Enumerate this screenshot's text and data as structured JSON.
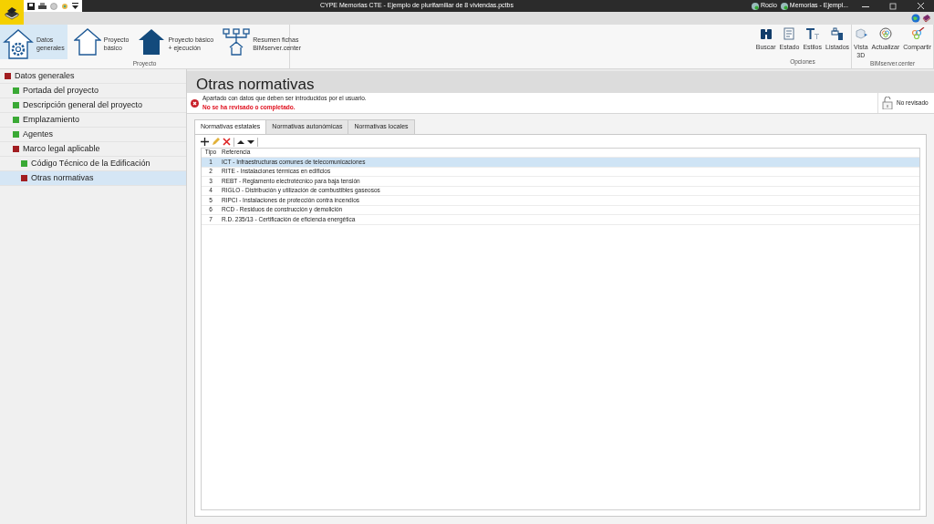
{
  "window": {
    "title": "CYPE Memorias CTE - Ejemplo de plurifamiliar de 8 viviendas.pctbs",
    "user": "Rocio",
    "document": "Memorias - Ejempl..."
  },
  "ribbon": {
    "groups": [
      {
        "label": "Proyecto",
        "buttons": [
          {
            "lines": [
              "Datos",
              "generales"
            ],
            "selected": true
          },
          {
            "lines": [
              "Proyecto",
              "básico"
            ],
            "selected": false
          },
          {
            "lines": [
              "Proyecto básico",
              "+ ejecución"
            ],
            "selected": false
          },
          {
            "lines": [
              "Resumen fichas",
              "BIMserver.center"
            ],
            "selected": false
          }
        ]
      },
      {
        "label": "Opciones",
        "buttons": [
          {
            "lines": [
              "Buscar"
            ],
            "selected": false
          },
          {
            "lines": [
              "Estado"
            ],
            "selected": false
          },
          {
            "lines": [
              "Estilos"
            ],
            "selected": false
          },
          {
            "lines": [
              "Listados"
            ],
            "selected": false
          }
        ]
      },
      {
        "label": "BIMserver.center",
        "buttons": [
          {
            "lines": [
              "Vista",
              "3D"
            ],
            "selected": false
          },
          {
            "lines": [
              "Actualizar"
            ],
            "selected": false
          },
          {
            "lines": [
              "Compartir"
            ],
            "selected": false
          }
        ]
      }
    ]
  },
  "sidebar": {
    "items": [
      {
        "label": "Datos generales",
        "color": "#a11d21",
        "selected": false,
        "children": [
          {
            "label": "Portada del proyecto",
            "color": "#3aa935",
            "selected": false
          },
          {
            "label": "Descripción general del proyecto",
            "color": "#3aa935",
            "selected": false
          },
          {
            "label": "Emplazamiento",
            "color": "#3aa935",
            "selected": false
          },
          {
            "label": "Agentes",
            "color": "#3aa935",
            "selected": false
          },
          {
            "label": "Marco legal aplicable",
            "color": "#a11d21",
            "selected": false,
            "children": [
              {
                "label": "Código Técnico de la Edificación",
                "color": "#3aa935",
                "selected": false
              },
              {
                "label": "Otras normativas",
                "color": "#a11d21",
                "selected": true
              }
            ]
          }
        ]
      }
    ]
  },
  "page": {
    "title": "Otras normativas",
    "notice": {
      "text": "Apartado con datos que deben ser introducidos por el usuario.",
      "status": "No se ha revisado o completado."
    },
    "review": {
      "label": "No revisado",
      "checked": false
    }
  },
  "tabs": [
    {
      "label": "Normativas estatales",
      "selected": true
    },
    {
      "label": "Normativas autonómicas",
      "selected": false
    },
    {
      "label": "Normativas locales",
      "selected": false
    }
  ],
  "table": {
    "columns": [
      "Tipo",
      "Referencia"
    ],
    "rows": [
      {
        "cells": [
          "1",
          "ICT - Infraestructuras comunes de telecomunicaciones"
        ],
        "selected": true
      },
      {
        "cells": [
          "2",
          "RITE - Instalaciones térmicas en edificios"
        ],
        "selected": false
      },
      {
        "cells": [
          "3",
          "REBT - Reglamento electrotécnico para baja tensión"
        ],
        "selected": false
      },
      {
        "cells": [
          "4",
          "RIGLO - Distribución y utilización de combustibles gaseosos"
        ],
        "selected": false
      },
      {
        "cells": [
          "5",
          "RIPCI - Instalaciones de protección contra incendios"
        ],
        "selected": false
      },
      {
        "cells": [
          "6",
          "RCD - Residuos de construcción y demolición"
        ],
        "selected": false
      },
      {
        "cells": [
          "7",
          "R.D. 235/13 - Certificación de eficiencia energética"
        ],
        "selected": false
      }
    ]
  }
}
